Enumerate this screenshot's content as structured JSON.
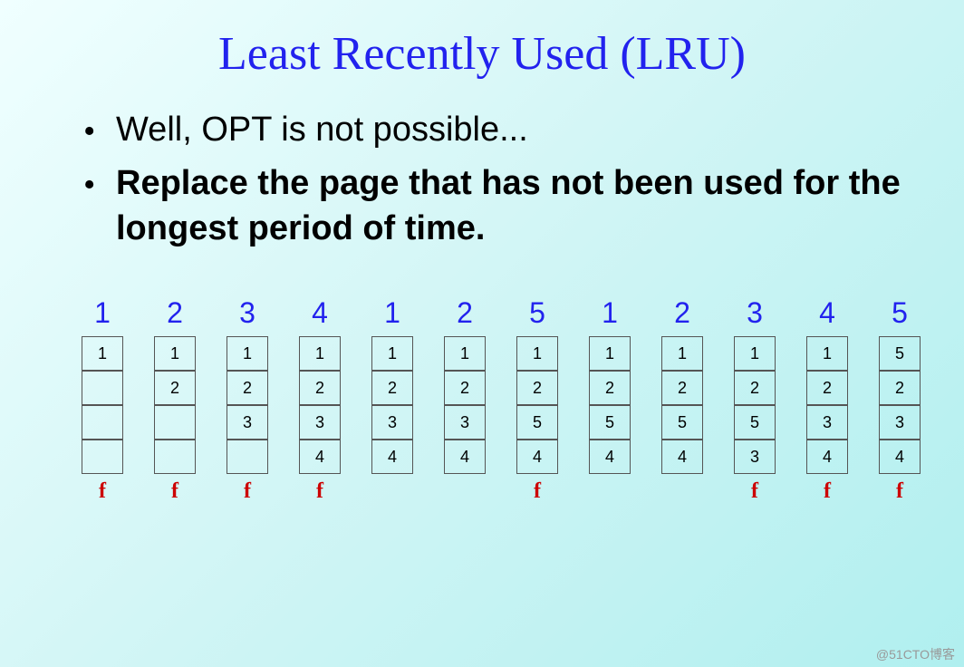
{
  "title": "Least Recently Used (LRU)",
  "bullets": [
    {
      "text": "Well, OPT is not possible...",
      "bold": false
    },
    {
      "text": "Replace the page that has not been used for the longest period of time.",
      "bold": true
    }
  ],
  "reference_string": [
    "1",
    "2",
    "3",
    "4",
    "1",
    "2",
    "5",
    "1",
    "2",
    "3",
    "4",
    "5"
  ],
  "columns": [
    {
      "frames": [
        "1",
        "",
        "",
        ""
      ],
      "fault": "f"
    },
    {
      "frames": [
        "1",
        "2",
        "",
        ""
      ],
      "fault": "f"
    },
    {
      "frames": [
        "1",
        "2",
        "3",
        ""
      ],
      "fault": "f"
    },
    {
      "frames": [
        "1",
        "2",
        "3",
        "4"
      ],
      "fault": "f"
    },
    {
      "frames": [
        "1",
        "2",
        "3",
        "4"
      ],
      "fault": ""
    },
    {
      "frames": [
        "1",
        "2",
        "3",
        "4"
      ],
      "fault": ""
    },
    {
      "frames": [
        "1",
        "2",
        "5",
        "4"
      ],
      "fault": "f"
    },
    {
      "frames": [
        "1",
        "2",
        "5",
        "4"
      ],
      "fault": ""
    },
    {
      "frames": [
        "1",
        "2",
        "5",
        "4"
      ],
      "fault": ""
    },
    {
      "frames": [
        "1",
        "2",
        "5",
        "3"
      ],
      "fault": "f"
    },
    {
      "frames": [
        "1",
        "2",
        "3",
        "4"
      ],
      "fault": "f"
    },
    {
      "frames": [
        "5",
        "2",
        "3",
        "4"
      ],
      "fault": "f"
    }
  ],
  "watermark": "@51CTO博客"
}
